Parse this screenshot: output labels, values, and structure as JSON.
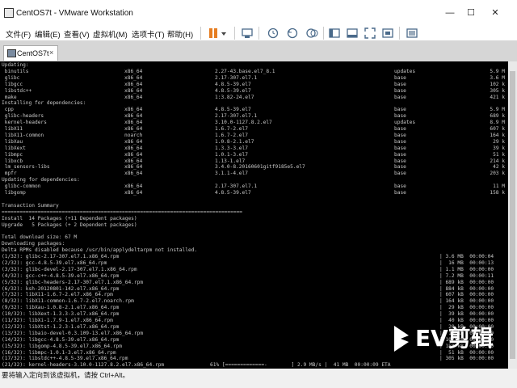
{
  "window": {
    "title": "CentOS7t - VMware Workstation",
    "minimize": "—",
    "maximize": "☐",
    "close": "✕"
  },
  "menu": [
    "文件(F)",
    "编辑(E)",
    "查看(V)",
    "虚拟机(M)",
    "选项卡(T)",
    "帮助(H)"
  ],
  "toolbar_icons": [
    "pause-icon",
    "dropdown-arrow-icon",
    "send-keys-icon",
    "snapshot-icon",
    "revert-snapshot-icon",
    "snapshot-manager-icon",
    "sidebar-icon",
    "console-view-icon",
    "fullscreen-icon",
    "unity-icon",
    "thumbnail-icon"
  ],
  "tab": {
    "label": "CentOS7t",
    "close": "×"
  },
  "console_lines": [
    [
      "Updating:"
    ],
    [
      " binutils",
      "x86_64",
      "2.27-43.base.el7_8.1",
      "updates",
      "5.9 M"
    ],
    [
      " glibc",
      "x86_64",
      "2.17-307.el7.1",
      "base",
      "3.6 M"
    ],
    [
      " libgcc",
      "x86_64",
      "4.8.5-39.el7",
      "base",
      "102 k"
    ],
    [
      " libstdc++",
      "x86_64",
      "4.8.5-39.el7",
      "base",
      "305 k"
    ],
    [
      " make",
      "x86_64",
      "1:3.82-24.el7",
      "base",
      "421 k"
    ],
    [
      "Installing for dependencies:"
    ],
    [
      " cpp",
      "x86_64",
      "4.8.5-39.el7",
      "base",
      "5.9 M"
    ],
    [
      " glibc-headers",
      "x86_64",
      "2.17-307.el7.1",
      "base",
      "689 k"
    ],
    [
      " kernel-headers",
      "x86_64",
      "3.10.0-1127.8.2.el7",
      "updates",
      "8.9 M"
    ],
    [
      " libX11",
      "x86_64",
      "1.6.7-2.el7",
      "base",
      "607 k"
    ],
    [
      " libX11-common",
      "noarch",
      "1.6.7-2.el7",
      "base",
      "164 k"
    ],
    [
      " libXau",
      "x86_64",
      "1.0.8-2.1.el7",
      "base",
      "29 k"
    ],
    [
      " libXext",
      "x86_64",
      "1.3.3-3.el7",
      "base",
      "39 k"
    ],
    [
      " libmpc",
      "x86_64",
      "1.0.1-3.el7",
      "base",
      "51 k"
    ],
    [
      " libxcb",
      "x86_64",
      "1.13-1.el7",
      "base",
      "214 k"
    ],
    [
      " lm_sensors-libs",
      "x86_64",
      "3.4.0-8.20160601gitf9185e5.el7",
      "base",
      "42 k"
    ],
    [
      " mpfr",
      "x86_64",
      "3.1.1-4.el7",
      "base",
      "203 k"
    ],
    [
      "Updating for dependencies:"
    ],
    [
      " glibc-common",
      "x86_64",
      "2.17-307.el7.1",
      "base",
      "11 M"
    ],
    [
      " libgomp",
      "x86_64",
      "4.8.5-39.el7",
      "base",
      "158 k"
    ],
    [
      ""
    ],
    [
      "Transaction Summary"
    ],
    [
      "================================================================================"
    ],
    [
      "Install  14 Packages (+11 Dependent packages)"
    ],
    [
      "Upgrade   5 Packages (+ 2 Dependent packages)"
    ],
    [
      ""
    ],
    [
      "Total download size: 67 M"
    ],
    [
      "Downloading packages:"
    ],
    [
      "Delta RPMs disabled because /usr/bin/applydeltarpm not installed."
    ],
    [
      "(1/32): glibc-2.17-307.el7.1.x86_64.rpm",
      "",
      "",
      "| 3.6 MB  00:00:04"
    ],
    [
      "(2/32): gcc-4.8.5-39.el7.x86_64.rpm",
      "",
      "",
      "|  16 MB  00:00:13"
    ],
    [
      "(3/32): glibc-devel-2.17-307.el7.1.x86_64.rpm",
      "",
      "",
      "| 1.1 MB  00:00:00"
    ],
    [
      "(4/32): gcc-c++-4.8.5-39.el7.x86_64.rpm",
      "",
      "",
      "| 7.2 MB  00:00:11"
    ],
    [
      "(5/32): glibc-headers-2.17-307.el7.1.x86_64.rpm",
      "",
      "",
      "| 689 kB  00:00:00"
    ],
    [
      "(6/32): ksh-20120801-142.el7.x86_64.rpm",
      "",
      "",
      "| 884 kB  00:00:00"
    ],
    [
      "(7/32): libX11-1.6.7-2.el7.x86_64.rpm",
      "",
      "",
      "| 607 kB  00:00:00"
    ],
    [
      "(8/32): libX11-common-1.6.7-2.el7.noarch.rpm",
      "",
      "",
      "| 164 kB  00:00:00"
    ],
    [
      "(9/32): libXau-1.0.8-2.1.el7.x86_64.rpm",
      "",
      "",
      "|  29 kB  00:00:00"
    ],
    [
      "(10/32): libXext-1.3.3-3.el7.x86_64.rpm",
      "",
      "",
      "|  39 kB  00:00:00"
    ],
    [
      "(11/32): libXi-1.7.9-1.el7.x86_64.rpm",
      "",
      "",
      "|  40 kB  00:00:00"
    ],
    [
      "(12/32): libXtst-1.2.3-1.el7.x86_64.rpm",
      "",
      "",
      "|  20 kB  00:00:00"
    ],
    [
      "(13/32): libaio-devel-0.3.109-13.el7.x86_64.rpm",
      "",
      "",
      "|  13 kB  00:00:00"
    ],
    [
      "(14/32): libgcc-4.8.5-39.el7.x86_64.rpm",
      "",
      "",
      "| 102 kB  00:00:00"
    ],
    [
      "(15/32): libgomp-4.8.5-39.el7.x86_64.rpm",
      "",
      "",
      "| 158 kB  00:00:00"
    ],
    [
      "(16/32): libmpc-1.0.1-3.el7.x86_64.rpm",
      "",
      "",
      "|  51 kB  00:00:00"
    ],
    [
      "(17/32): libstdc++-4.8.5-39.el7.x86_64.rpm",
      "",
      "",
      "| 305 kB  00:00:00"
    ],
    [
      "(21/32): kernel-headers-3.10.0-1127.8.2.el7.x86_64.rpm",
      "61% [=============-        ] 2.9 MB/s |  41 MB  00:00:09 ETA"
    ]
  ],
  "statusbar": {
    "text": "要将输入定向到该虚拟机，请按 Ctrl+Alt。"
  },
  "watermark": {
    "text": "EV剪辑"
  }
}
